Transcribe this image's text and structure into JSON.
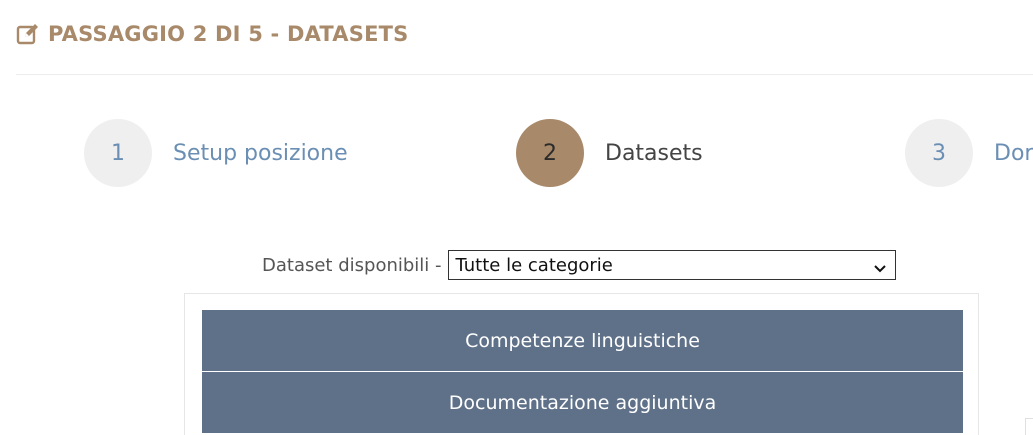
{
  "header": {
    "title": "PASSAGGIO 2 DI 5 - DATASETS",
    "icon": "edit-icon",
    "color": "#a8896a"
  },
  "steps": [
    {
      "number": "1",
      "label": "Setup posizione",
      "active": false
    },
    {
      "number": "2",
      "label": "Datasets",
      "active": true
    },
    {
      "number": "3",
      "label": "Dor",
      "active": false
    }
  ],
  "filter": {
    "label": "Dataset disponibili -",
    "selected": "Tutte le categorie"
  },
  "datasets": [
    {
      "label": "Competenze linguistiche"
    },
    {
      "label": "Documentazione aggiuntiva"
    }
  ],
  "colors": {
    "accent": "#a8896a",
    "link": "#6b8fb4",
    "dataset_bg": "#5f7189"
  }
}
